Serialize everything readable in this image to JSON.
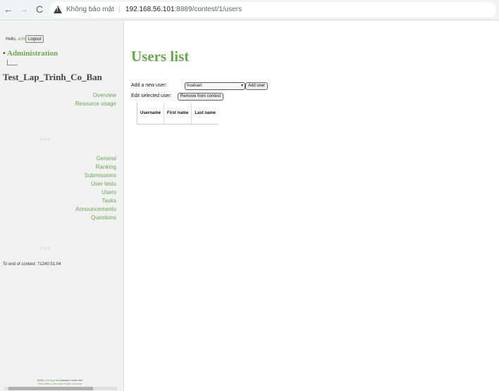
{
  "browser": {
    "security_text": "Không bảo mật",
    "url_host": "192.168.56.101",
    "url_rest": ":8889/contest/1/users"
  },
  "sidebar": {
    "hello": "Hello,",
    "username": "admin",
    "logout": "Logout",
    "admin_link": "Administration",
    "contest_name": "Test_Lap_Trinh_Co_Ban",
    "menu_top": [
      "Overview",
      "Resource usage"
    ],
    "menu_main": [
      "General",
      "Ranking",
      "Submissions",
      "User tests",
      "Users",
      "Tasks",
      "Announcements",
      "Questions"
    ],
    "separator": "○○○",
    "end_of_contest": "To end of contest: 71240:51:04",
    "footer_line1_pre": "CMS",
    "footer_link": "prototype",
    "footer_line1_post": "is released under the",
    "footer_line2": "GNU Affero General Public License"
  },
  "main": {
    "title": "Users list",
    "add_label": "Add a new user:",
    "selected_user": "hoatuan",
    "add_button": "Add user",
    "edit_label": "Edit selected user:",
    "remove_button": "Remove from contest",
    "columns": [
      "Username",
      "First name",
      "Last name"
    ]
  }
}
